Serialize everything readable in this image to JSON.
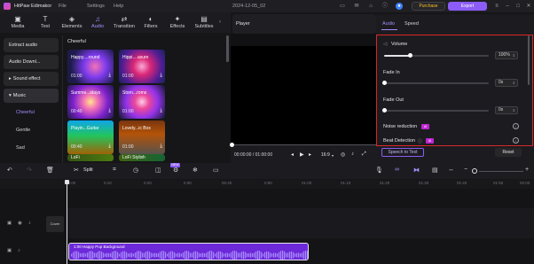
{
  "app": {
    "name": "HitPaw Edimakor",
    "menu": [
      "File",
      "Settings",
      "Help"
    ],
    "date": "2024-12-05_02",
    "purchase": "Purchase",
    "export": "Export"
  },
  "toolbar": {
    "items": [
      {
        "label": "Media",
        "icon": "media-icon"
      },
      {
        "label": "Text",
        "icon": "text-icon"
      },
      {
        "label": "Elements",
        "icon": "elements-icon"
      },
      {
        "label": "Audio",
        "icon": "audio-icon"
      },
      {
        "label": "Transition",
        "icon": "transition-icon"
      },
      {
        "label": "Filters",
        "icon": "filters-icon"
      },
      {
        "label": "Effects",
        "icon": "effects-icon"
      },
      {
        "label": "Subtitles",
        "icon": "subtitles-icon"
      }
    ],
    "active": "Audio"
  },
  "sidebar": {
    "items": [
      "Extract audio",
      "Audio Downl...",
      "Sound effect",
      "Music"
    ],
    "music_sub": [
      "Cheerful",
      "Gentle",
      "Sad"
    ],
    "active_sub": "Cheerful"
  },
  "library": {
    "category": "Cheerful",
    "cards": [
      {
        "title": "Happy....round",
        "duration": "01:00"
      },
      {
        "title": "Hippi....asure",
        "duration": "01:00"
      },
      {
        "title": "Summe...idays",
        "duration": "00:40"
      },
      {
        "title": "Storn...roms",
        "duration": "01:00"
      },
      {
        "title": "Playin...Guitar",
        "duration": "00:40"
      },
      {
        "title": "Lovely...ic Box",
        "duration": "01:00"
      },
      {
        "title": "LoFi",
        "duration": ""
      },
      {
        "title": "LoFi Stylish",
        "duration": ""
      }
    ]
  },
  "player": {
    "title": "Player",
    "timecode": "00:00:00 / 01:00:00",
    "ratio": "16:9"
  },
  "right_panel": {
    "tabs": [
      "Audio",
      "Speed"
    ],
    "volume": {
      "label": "Volume",
      "value": "100%",
      "fraction": 0.25
    },
    "fade_in": {
      "label": "Fade In",
      "value": "0s",
      "fraction": 0
    },
    "fade_out": {
      "label": "Fade Out",
      "value": "0s",
      "fraction": 0
    },
    "noise_reduction": {
      "label": "Noise reduction",
      "badge": "AI"
    },
    "beat_detection": {
      "label": "Beat Detection",
      "badge": "AI"
    },
    "speech_to_text": "Speech to Text",
    "reset": "Reset"
  },
  "edit_toolbar": {
    "split": "Split",
    "new_badge": "NEW"
  },
  "ruler": {
    "ticks": [
      "00:00",
      "0:10",
      "0:20",
      "0:30",
      "00:40",
      "0:50",
      "01:00",
      "01:10",
      "01:20",
      "01:30",
      "01:40",
      "01:50",
      "02:00"
    ]
  },
  "timeline": {
    "cover_label": "Cover",
    "audio_clip": "1:00 Happy Pop Background"
  },
  "colors": {
    "accent": "#8b5cf6",
    "highlight_border": "#dc2626",
    "clip": "#6d28d9"
  }
}
